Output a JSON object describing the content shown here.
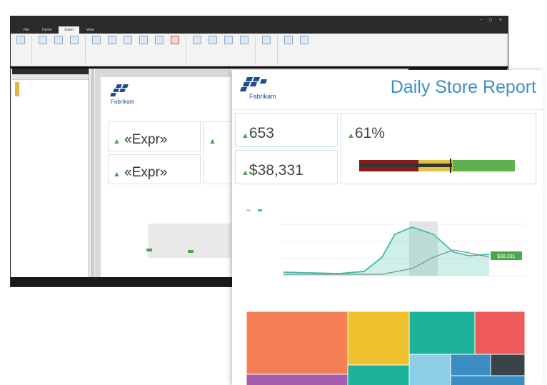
{
  "builder": {
    "tabs": [
      "File",
      "Home",
      "Insert",
      "View"
    ],
    "active_tab": "Insert",
    "ribbon_items": [
      "",
      "",
      "",
      "",
      "",
      "",
      "",
      "",
      "",
      "",
      "",
      "",
      "",
      "",
      "",
      "",
      "",
      "",
      ""
    ],
    "data_pane": {
      "tree": [
        "",
        "",
        "",
        "",
        ""
      ]
    },
    "design": {
      "cards": [
        {
          "value": "«Expr»"
        },
        {
          "value": "«Expr»"
        },
        {
          "value": ""
        }
      ],
      "badges": [
        "",
        ""
      ]
    }
  },
  "report": {
    "logo_text": "Fabrikam",
    "title": "Daily Store Report",
    "kpis": {
      "store_traffic": {
        "value": "653",
        "trend": "up"
      },
      "sales": {
        "value": "$38,331",
        "trend": "up"
      },
      "conversion_rate": {
        "value": "61%",
        "trend": "up"
      }
    },
    "bullet_colors": [
      "#8b1a1a",
      "#e2c341",
      "#5fb04f"
    ],
    "trend": {
      "callout": "$38,331",
      "colors": {
        "primary": "#3fbfa8",
        "secondary": "#7a8f8c"
      }
    },
    "treemap_colors": [
      "#f47f55",
      "#eec12d",
      "#1cb39a",
      "#ee5a5a",
      "#a45cae",
      "#8ecfe8",
      "#3b8ec4",
      "#3a4347"
    ]
  }
}
